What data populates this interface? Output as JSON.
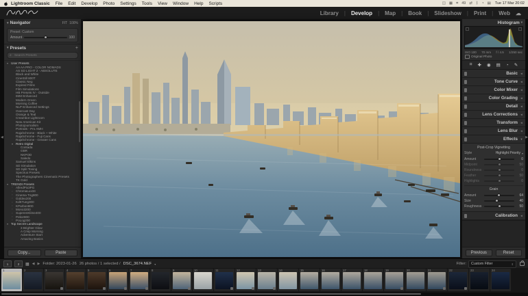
{
  "menubar": {
    "items": [
      {
        "t": "Lightroom Classic",
        "b": true
      },
      {
        "t": "File"
      },
      {
        "t": "Edit"
      },
      {
        "t": "Develop"
      },
      {
        "t": "Photo"
      },
      {
        "t": "Settings"
      },
      {
        "t": "Tools"
      },
      {
        "t": "View"
      },
      {
        "t": "Window"
      },
      {
        "t": "Help"
      },
      {
        "t": "Scripts"
      }
    ],
    "status_icons": [
      {
        "g": "◫"
      },
      {
        "g": "▦"
      },
      {
        "g": "⌗"
      },
      {
        "g": "49"
      },
      {
        "g": "⇄"
      },
      {
        "g": "ᛒ"
      },
      {
        "g": "◔"
      },
      {
        "g": "▤"
      }
    ],
    "clock": "Tue 17 Mar 20:02"
  },
  "modules": {
    "items": [
      {
        "t": "Library"
      },
      {
        "t": "Develop",
        "active": true
      },
      {
        "t": "Map"
      },
      {
        "t": "Book"
      },
      {
        "t": "Slideshow"
      },
      {
        "t": "Print"
      },
      {
        "t": "Web"
      }
    ],
    "cloud": "☁"
  },
  "left": {
    "navigator": {
      "title": "Navigator",
      "tri": "▾",
      "zoom_fit": "FIT",
      "zoom_level": "100%"
    },
    "amount_box": {
      "preset_line": "Preset: Custom",
      "label": "Amount",
      "value": "100",
      "pos": "50%"
    },
    "presets": {
      "title": "Presets",
      "tri": "▾",
      "add": "+",
      "search_placeholder": "Search Presets"
    },
    "rows": [
      {
        "g": "▾",
        "t": "User Presets",
        "head": true,
        "pad": "2px"
      },
      {
        "t": "AA AA PRO - COLOR NOMADS",
        "pad": "9px"
      },
      {
        "t": "AS SD LIGHT 2 - ABSOLUTE",
        "pad": "9px"
      },
      {
        "t": "Black and White",
        "pad": "9px"
      },
      {
        "t": "CineStill 800T",
        "pad": "9px"
      },
      {
        "t": "Classic Neg",
        "pad": "9px"
      },
      {
        "t": "Expired Films",
        "pad": "9px"
      },
      {
        "t": "Film Simulations",
        "pad": "9px"
      },
      {
        "t": "HB Presets IV - Outside",
        "pad": "9px"
      },
      {
        "t": "IMM Enhanced",
        "pad": "9px"
      },
      {
        "t": "Modern Green",
        "pad": "9px"
      },
      {
        "t": "Morning Coffee",
        "pad": "9px"
      },
      {
        "t": "NLP Enhanced Settings",
        "pad": "9px"
      },
      {
        "t": "Overcast Day",
        "pad": "9px"
      },
      {
        "t": "Orange & Teal",
        "pad": "9px"
      },
      {
        "t": "Creambot Lightroom",
        "pad": "9px"
      },
      {
        "t": "New American Kit",
        "pad": "9px"
      },
      {
        "t": "Photojournalism",
        "pad": "9px"
      },
      {
        "t": "Portraits - Pro AMH",
        "pad": "9px"
      },
      {
        "t": "Rajahchrome - Black + White",
        "pad": "9px"
      },
      {
        "t": "Rajahchrome - Fuji Cans",
        "pad": "9px"
      },
      {
        "t": "Rajahchrome - Greater Cans",
        "pad": "9px"
      },
      {
        "g": "▾",
        "t": "Retro Digital",
        "head": true,
        "pad": "9px"
      },
      {
        "t": "Contada",
        "pad": "16px"
      },
      {
        "t": "GBR",
        "pad": "16px"
      },
      {
        "t": "NKPOD",
        "pad": "16px"
      },
      {
        "t": "Saledo",
        "pad": "16px"
      },
      {
        "t": "Samuel Elkins",
        "pad": "9px"
      },
      {
        "t": "SD Simulation",
        "pad": "9px"
      },
      {
        "t": "SD Split Toning",
        "pad": "9px"
      },
      {
        "t": "Spectrus Presets",
        "pad": "9px"
      },
      {
        "t": "The Photographers Cinematic Presets",
        "pad": "9px"
      },
      {
        "t": "TK Gold",
        "pad": "9px"
      },
      {
        "g": "▾",
        "t": "TRENDI Presets",
        "head": true,
        "pad": "2px"
      },
      {
        "g": "▫",
        "t": "AllredPix3PG",
        "pad": "9px"
      },
      {
        "g": "▫",
        "t": "ChromaLux34",
        "pad": "9px"
      },
      {
        "g": "▫",
        "t": "Cinema Tng800",
        "pad": "9px"
      },
      {
        "g": "▫",
        "t": "Goldex200",
        "pad": "9px"
      },
      {
        "g": "▫",
        "t": "KdKTung300",
        "pad": "9px"
      },
      {
        "g": "▫",
        "t": "KParbon800",
        "pad": "9px"
      },
      {
        "g": "▫",
        "t": "Mono3200",
        "pad": "9px"
      },
      {
        "g": "▫",
        "t": "SuperenKlime400",
        "pad": "9px"
      },
      {
        "g": "▫",
        "t": "Pekor800",
        "pad": "9px"
      },
      {
        "g": "▫",
        "t": "PoLog200",
        "pad": "9px"
      },
      {
        "g": "▾",
        "t": "Top Secret Landscape",
        "head": true,
        "pad": "2px"
      },
      {
        "t": "3 Brighter Glow",
        "pad": "16px"
      },
      {
        "t": "A Crisp Morning",
        "pad": "16px"
      },
      {
        "t": "Adventure Start",
        "pad": "16px"
      },
      {
        "t": "Amazing Basics",
        "pad": "16px"
      }
    ],
    "copy": "Copy...",
    "paste": "Paste"
  },
  "right": {
    "histogram": {
      "title": "Histogram",
      "tri": "▾",
      "meta": [
        "ISO 100",
        "70 mm",
        "f / 4.5",
        "1/250 sec"
      ],
      "original": "Original Photo"
    },
    "tools": [
      {
        "g": "⌗"
      },
      {
        "g": "✚"
      },
      {
        "g": "◉"
      },
      {
        "g": "▤"
      },
      {
        "g": "◔"
      },
      {
        "g": "✎"
      }
    ],
    "panels": [
      {
        "label": "Basic"
      },
      {
        "label": "Tone Curve"
      },
      {
        "label": "Color Mixer"
      },
      {
        "label": "Color Grading"
      },
      {
        "label": "Detail"
      },
      {
        "label": "Lens Corrections"
      },
      {
        "label": "Transform"
      },
      {
        "label": "Lens Blur"
      }
    ],
    "effects": {
      "label": "Effects",
      "section1": "Post-Crop Vignetting",
      "style_label": "Style",
      "style_value": "Highlight Priority",
      "vignette_sliders": [
        {
          "label": "Amount",
          "value": "0",
          "pos": "50%"
        },
        {
          "label": "Midpoint",
          "value": "50",
          "pos": "50%",
          "dim": true
        },
        {
          "label": "Roundness",
          "value": "0",
          "pos": "50%",
          "dim": true
        },
        {
          "label": "Feather",
          "value": "50",
          "pos": "50%",
          "dim": true
        },
        {
          "label": "Highlights",
          "value": "0",
          "pos": "50%",
          "dim": true
        }
      ],
      "section2": "Grain",
      "grain_sliders": [
        {
          "label": "Amount",
          "value": "64",
          "pos": "47%"
        },
        {
          "label": "Size",
          "value": "40",
          "pos": "42%"
        },
        {
          "label": "Roughness",
          "value": "50",
          "pos": "50%"
        }
      ]
    },
    "calibration": {
      "label": "Calibration"
    },
    "previous": "Previous",
    "reset": "Reset"
  },
  "filmstrip": {
    "toolbar": {
      "monitor1": "1",
      "monitor2": "2",
      "folder": "Folder: 2023-01-26",
      "count": "26 photos / 1 selected /",
      "filename": "DSC_3674.NEF",
      "filter_label": "Filter:",
      "filter_value": "Custom Filter"
    },
    "thumbs": [
      {
        "n": "1",
        "bg": "linear-gradient(#cfc4a8,#6d8da0)",
        "sel": true
      },
      {
        "n": "2",
        "bg": "linear-gradient(#2a3240,#141a24)"
      },
      {
        "n": "3",
        "bg": "linear-gradient(#3a3632,#17140f)",
        "badge": true
      },
      {
        "n": "4",
        "bg": "linear-gradient(#54402e,#201710)"
      },
      {
        "n": "5",
        "bg": "linear-gradient(#4e3a2a,#1d140e)",
        "badge": true
      },
      {
        "n": "6",
        "bg": "linear-gradient(#c7a277,#33475c)",
        "badge": true
      },
      {
        "n": "7",
        "bg": "linear-gradient(#d0ac80,#3c5068)",
        "badge": true
      },
      {
        "n": "8",
        "bg": "linear-gradient(#23262c,#0d0e12)"
      },
      {
        "n": "9",
        "bg": "linear-gradient(#c3b49c,#4e6378)",
        "badge": true
      },
      {
        "n": "10",
        "bg": "linear-gradient(#d8d5cd,#9aa2a6)"
      },
      {
        "n": "11",
        "bg": "linear-gradient(#20304a,#0c1322)",
        "badge": true
      },
      {
        "n": "12",
        "bg": "linear-gradient(#cfc6b0,#7b94a4)",
        "badge": true
      },
      {
        "n": "13",
        "bg": "linear-gradient(#b9b4a8,#6a7f8e)",
        "badge": true
      },
      {
        "n": "14",
        "bg": "linear-gradient(#ccc4b2,#8195a3)"
      },
      {
        "n": "15",
        "bg": "linear-gradient(#b4aca0,#3f566b)"
      },
      {
        "n": "16",
        "bg": "linear-gradient(#b2aba0,#3d546a)"
      },
      {
        "n": "17",
        "bg": "linear-gradient(#aea79c,#3b5268)"
      },
      {
        "n": "18",
        "bg": "linear-gradient(#aaa499,#394f66)"
      },
      {
        "n": "19",
        "bg": "linear-gradient(#a7a096,#374d63)",
        "badge": true
      },
      {
        "n": "20",
        "bg": "linear-gradient(#a39d93,#344a60)"
      },
      {
        "n": "21",
        "bg": "linear-gradient(#9f9a90,#32485e)",
        "badge": true
      },
      {
        "n": "22",
        "bg": "linear-gradient(#1c2739,#0a0f1a)",
        "badge": true
      },
      {
        "n": "23",
        "bg": "linear-gradient(#18202e,#070b12)"
      },
      {
        "n": "24",
        "bg": "linear-gradient(#1a2a44,#0a111e)"
      }
    ]
  },
  "colors": {
    "accent_selection": "#b8b8b8",
    "panel_bg": "#2b2b2b",
    "menubar_bg": "#eae5d9"
  }
}
